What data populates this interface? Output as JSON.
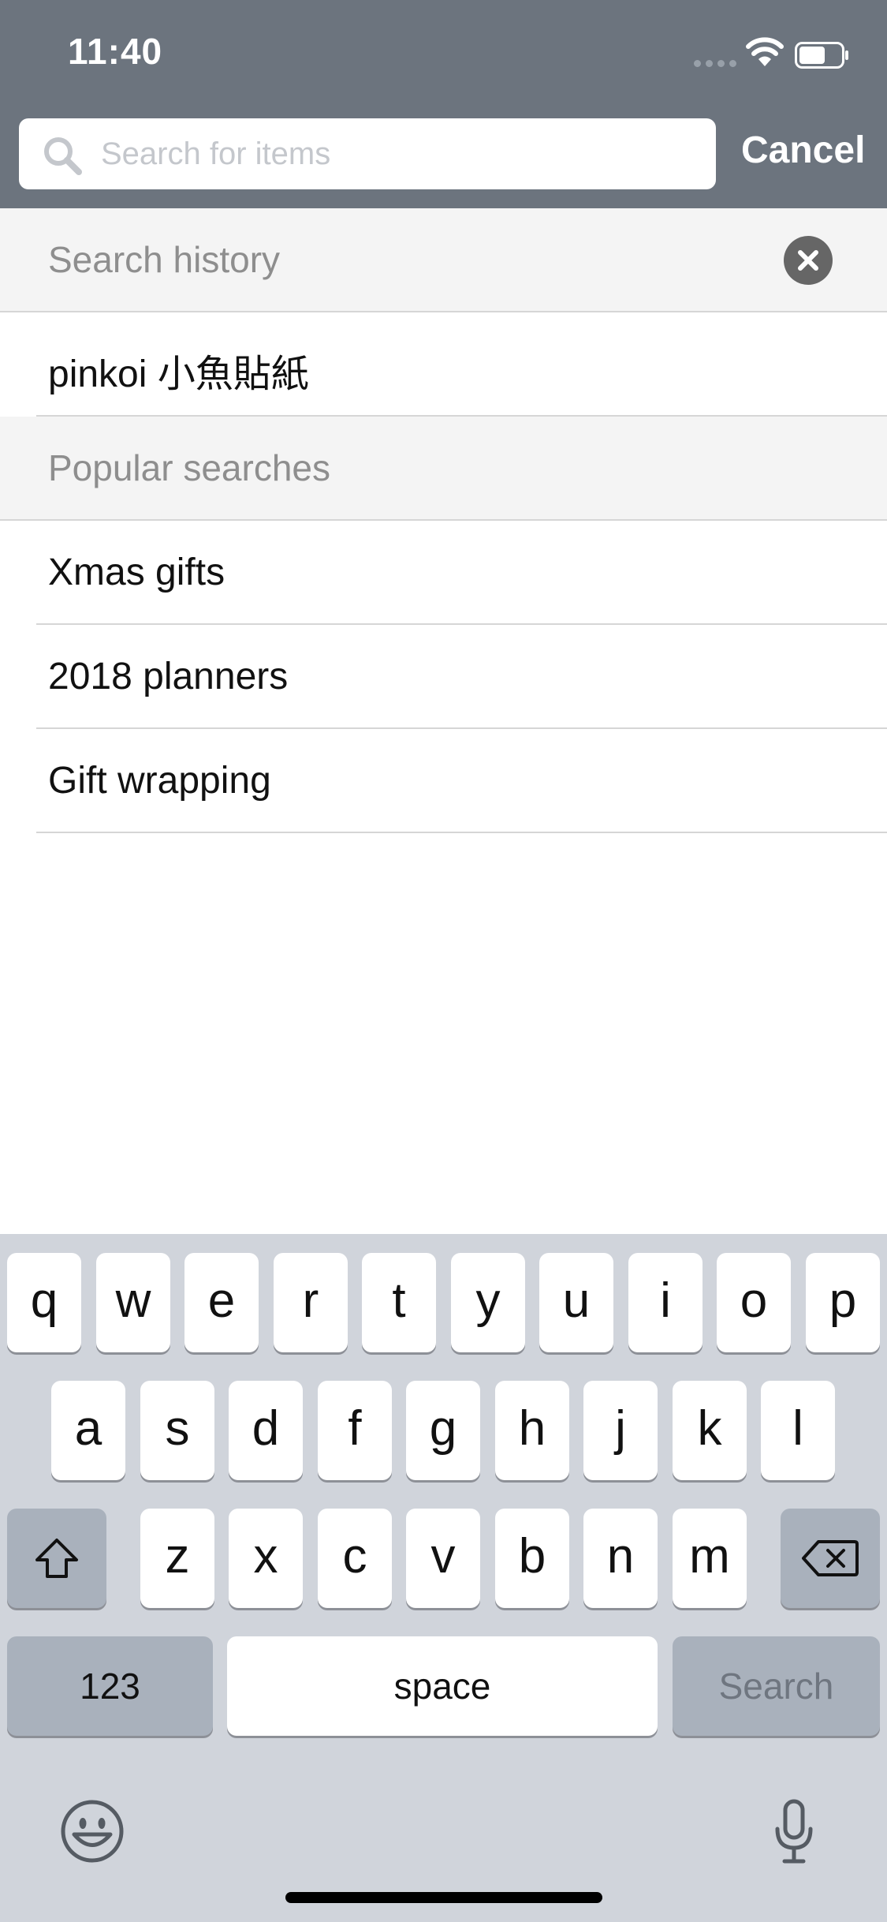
{
  "status_bar": {
    "time": "11:40",
    "icons": [
      "signal-dots-icon",
      "wifi-icon",
      "battery-icon"
    ]
  },
  "search": {
    "placeholder": "Search for items",
    "value": "",
    "cancel_label": "Cancel"
  },
  "history": {
    "title": "Search history",
    "clear_icon": "clear-circle-icon",
    "items": [
      "pinkoi 小魚貼紙"
    ]
  },
  "popular": {
    "title": "Popular searches",
    "items": [
      "Xmas gifts",
      "2018 planners",
      "Gift wrapping"
    ]
  },
  "keyboard": {
    "row1": [
      "q",
      "w",
      "e",
      "r",
      "t",
      "y",
      "u",
      "i",
      "o",
      "p"
    ],
    "row2": [
      "a",
      "s",
      "d",
      "f",
      "g",
      "h",
      "j",
      "k",
      "l"
    ],
    "row3": [
      "z",
      "x",
      "c",
      "v",
      "b",
      "n",
      "m"
    ],
    "numbers_label": "123",
    "space_label": "space",
    "search_label": "Search",
    "icons": [
      "shift-icon",
      "backspace-icon",
      "emoji-icon",
      "microphone-icon"
    ]
  },
  "colors": {
    "header_bg": "#6c747e",
    "section_bg": "#f4f4f4",
    "keyboard_bg": "#d0d4db"
  }
}
